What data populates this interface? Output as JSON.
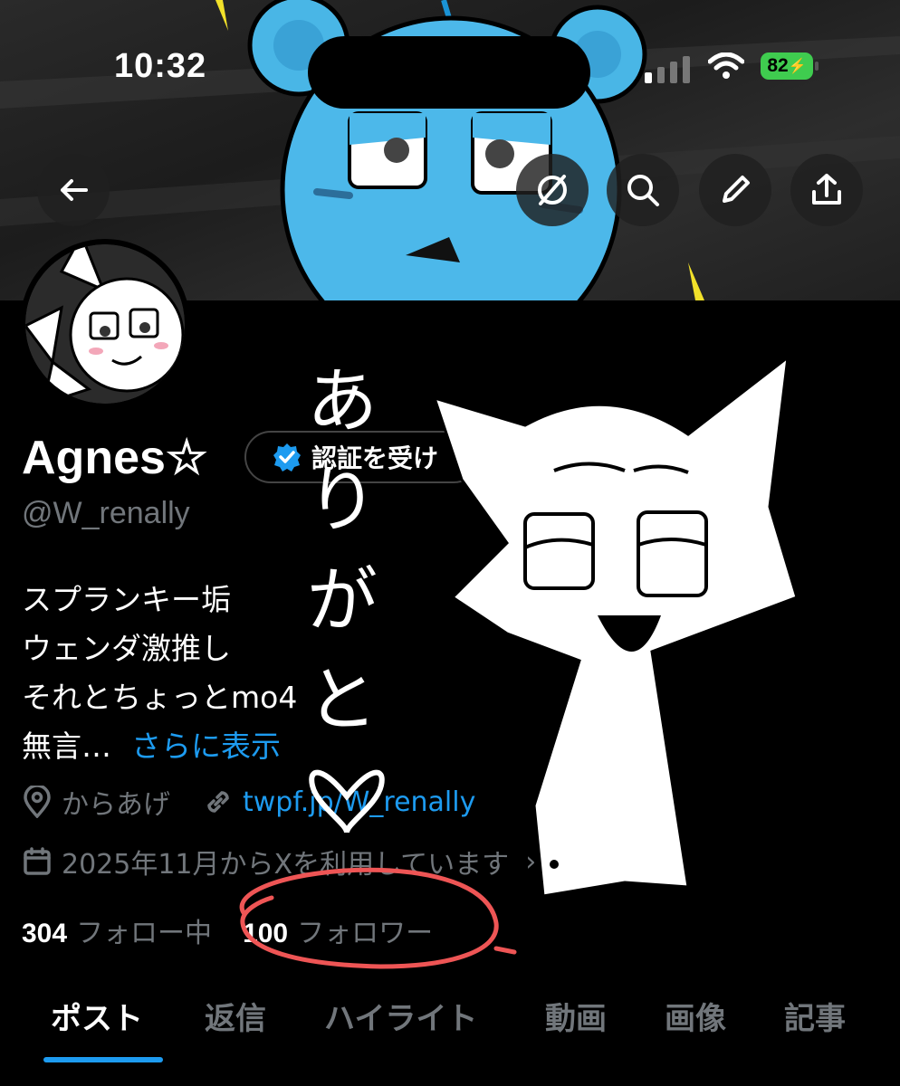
{
  "status_bar": {
    "time": "10:32",
    "battery": "82"
  },
  "header": {
    "icons": [
      "back-arrow-icon",
      "grok-icon",
      "search-icon",
      "edit-icon",
      "share-icon"
    ]
  },
  "profile": {
    "name": "Agnes☆",
    "verify_button": "認証を受け",
    "handle": "@W_renally",
    "bio": [
      "スプランキー垢",
      "ウェンダ激推し",
      "それとちょっとmo4",
      "無言…"
    ],
    "show_more": "さらに表示",
    "location": "からあげ",
    "link": "twpf.jp/W_renally",
    "joined": "2025年11月からXを利用しています",
    "following_count": "304",
    "following_label": "フォロー中",
    "followers_count": "100",
    "followers_label": "フォロワー"
  },
  "tabs": [
    "ポスト",
    "返信",
    "ハイライト",
    "動画",
    "画像",
    "記事"
  ],
  "active_tab": "ポスト",
  "overlay_text": "ありがと♡",
  "colors": {
    "accent": "#1d9bf0",
    "battery": "#3fcc4f",
    "circle_mark": "#ee5555"
  }
}
